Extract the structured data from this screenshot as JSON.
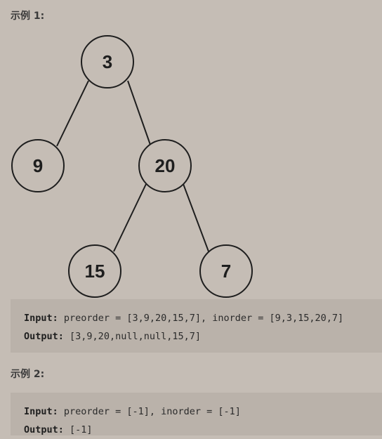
{
  "example1": {
    "heading": "示例 1:",
    "tree": {
      "nodes": [
        {
          "id": "n3",
          "label": "3"
        },
        {
          "id": "n9",
          "label": "9"
        },
        {
          "id": "n20",
          "label": "20"
        },
        {
          "id": "n15",
          "label": "15"
        },
        {
          "id": "n7",
          "label": "7"
        }
      ],
      "edges": [
        {
          "from": "n3",
          "to": "n9"
        },
        {
          "from": "n3",
          "to": "n20"
        },
        {
          "from": "n20",
          "to": "n15"
        },
        {
          "from": "n20",
          "to": "n7"
        }
      ]
    },
    "input_label": "Input:",
    "input_value": "preorder = [3,9,20,15,7], inorder = [9,3,15,20,7]",
    "output_label": "Output:",
    "output_value": "[3,9,20,null,null,15,7]"
  },
  "example2": {
    "heading": "示例 2:",
    "input_label": "Input:",
    "input_value": "preorder = [-1], inorder = [-1]",
    "output_label": "Output:",
    "output_value": "[-1]"
  }
}
